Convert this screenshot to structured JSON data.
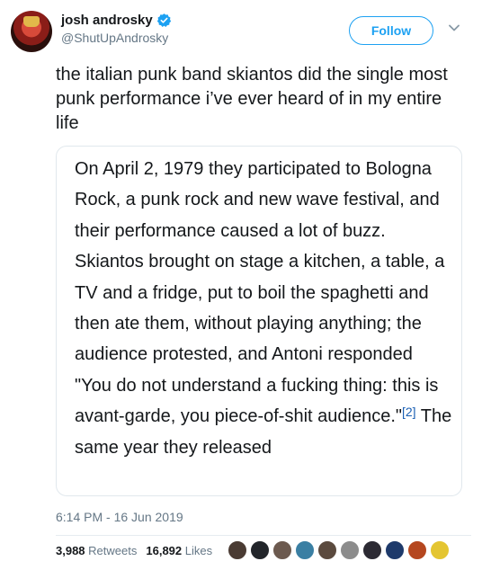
{
  "author": {
    "display_name": "josh androsky",
    "handle": "@ShutUpAndrosky",
    "verified": true
  },
  "follow_button": {
    "label": "Follow"
  },
  "tweet": {
    "text": "the italian punk band skiantos did the single most punk performance i’ve ever heard of in my entire life"
  },
  "quote": {
    "text_before_ref": "On April 2, 1979 they participated to Bologna Rock, a punk rock and new wave festival, and their performance caused a lot of buzz. Skiantos brought on stage a kitchen, a table, a TV and a fridge, put to boil the spaghetti and then ate them, without playing anything; the audience protested, and Antoni responded \"You do not understand a fucking thing: this is avant-garde, you piece-of-shit audience.\"",
    "ref": "[2]",
    "text_after_ref": " The same year they released"
  },
  "meta": {
    "timestamp": "6:14 PM - 16 Jun 2019"
  },
  "stats": {
    "retweets_count": "3,988",
    "retweets_label": "Retweets",
    "likes_count": "16,892",
    "likes_label": "Likes"
  },
  "colors": {
    "accent": "#1da1f2",
    "secondary_text": "#657786",
    "primary_text": "#14171a"
  },
  "liker_avatar_colors": [
    "#4a3b33",
    "#22252a",
    "#6c5a4f",
    "#3a7fa3",
    "#5b4a3e",
    "#8c8c8c",
    "#2c2a33",
    "#1e3a6b",
    "#b5471f",
    "#e4c531"
  ]
}
